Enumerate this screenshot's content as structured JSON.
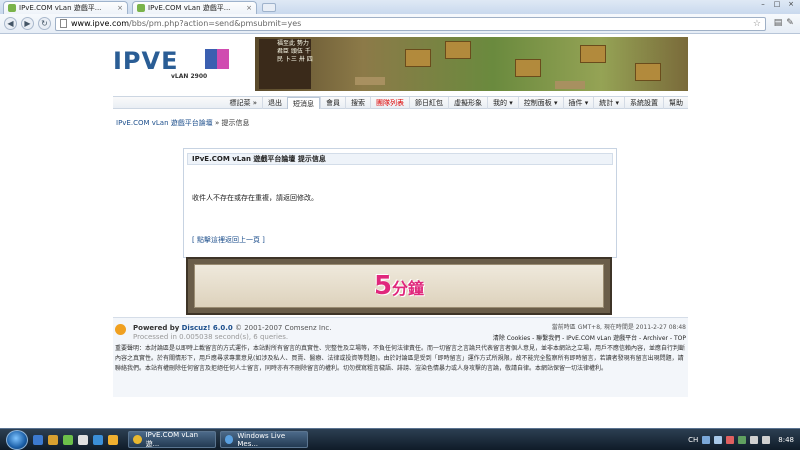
{
  "browser": {
    "tabs": [
      {
        "label": "IPvE.COM vLan 遊戲平..."
      },
      {
        "label": "IPvE.COM vLan 遊戲平..."
      }
    ],
    "url_host": "www.ipve.com",
    "url_path": "/bbs/pm.php?action=send&pmsubmit=yes"
  },
  "header": {
    "logo_text": "IPVE",
    "logo_sub": "vLAN 2900",
    "hero_text": "福至此 勢力 君臣 頭伍 千民 卜三 卅 四"
  },
  "menu": [
    "標記菜 »",
    "退出",
    "短消息",
    "會員",
    "搜索",
    "團隊列表",
    "節日紅包",
    "虛擬形象",
    "我的 ▾",
    "控制面板 ▾",
    "插件 ▾",
    "統計 ▾",
    "系統設置",
    "幫助"
  ],
  "breadcrumb": {
    "site": "IPvE.COM vLan 遊戲平台論壇",
    "sep": " » ",
    "current": "提示信息"
  },
  "message": {
    "header": "IPvE.COM vLan 遊戲平台論壇 提示信息",
    "text": "收件人不存在或存在重複，請返回修改。",
    "back_link": "[ 點擊這裡返回上一頁 ]"
  },
  "ad": {
    "big": "5",
    "small": "分鐘"
  },
  "footer": {
    "powered": "Powered by",
    "product": "Discuz! 6.0.0",
    "copyright": "© 2001-2007 Comsenz Inc.",
    "processed": "Processed in 0.005038 second(s), 6 queries.",
    "time": "當前時區 GMT+8, 現在時間是 2011-2-27 08:48",
    "links": "清除 Cookies - 聯繫我們 - IPvE.COM vLan 遊戲平台 - Archiver - TOP",
    "notice": "重要聲明：本討論區是以即時上載留言的方式運作，本站對所有留言的真實性、完整性及立場等，不負任何法律責任。而一切留言之言論只代表留言者個人意見，並非本網站之立場，用戶不應信賴內容，並應自行判斷內容之真實性。於有關情形下，用戶應尋求專業意見(如涉及私人、買賣、醫療、法律或投資等問題)。由於討論區是受到「即時留言」運作方式所規限，故不能完全監察所有即時留言，若讀者發現有留言出現問題，請聯絡我們。本站有權刪除任何留言及拒絕任何人士留言，同時亦有不刪除留言的權利。切勿撰寫粗言穢語、誹謗、渲染色情暴力或人身攻擊的言論，敬請自律。本網站保留一切法律權利。"
  },
  "taskbar": {
    "tasks": [
      "IPvE.COM vLan 遊...",
      "Windows Live Mes..."
    ],
    "lang": "CH",
    "clock": "8:48"
  }
}
